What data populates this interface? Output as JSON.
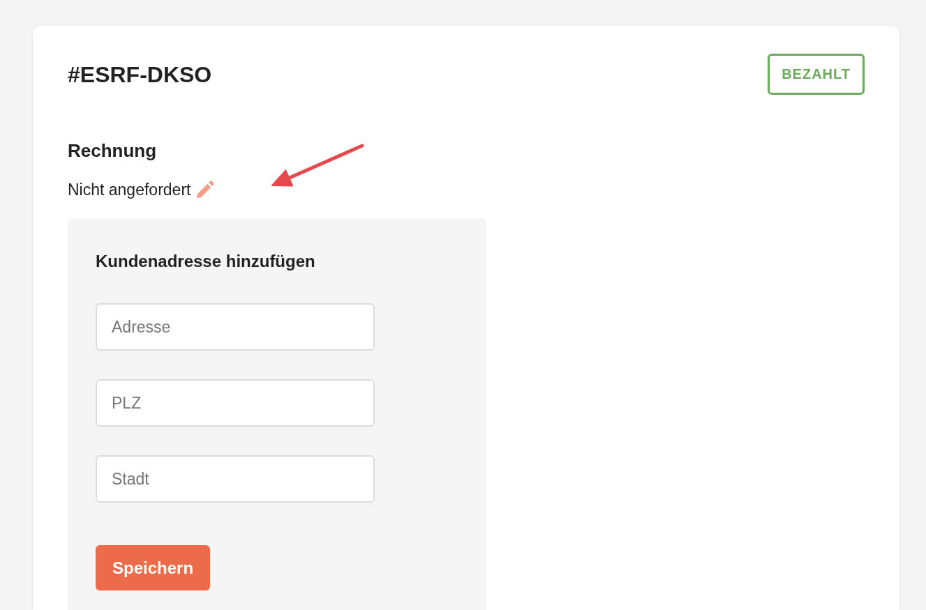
{
  "order": {
    "number": "#ESRF-DKSO",
    "status_badge": "BEZAHLT"
  },
  "invoice": {
    "heading": "Rechnung",
    "status": "Nicht angefordert"
  },
  "address_form": {
    "heading": "Kundenadresse hinzufügen",
    "fields": [
      {
        "placeholder": "Adresse"
      },
      {
        "placeholder": "PLZ"
      },
      {
        "placeholder": "Stadt"
      }
    ],
    "submit_button": "Speichern"
  }
}
